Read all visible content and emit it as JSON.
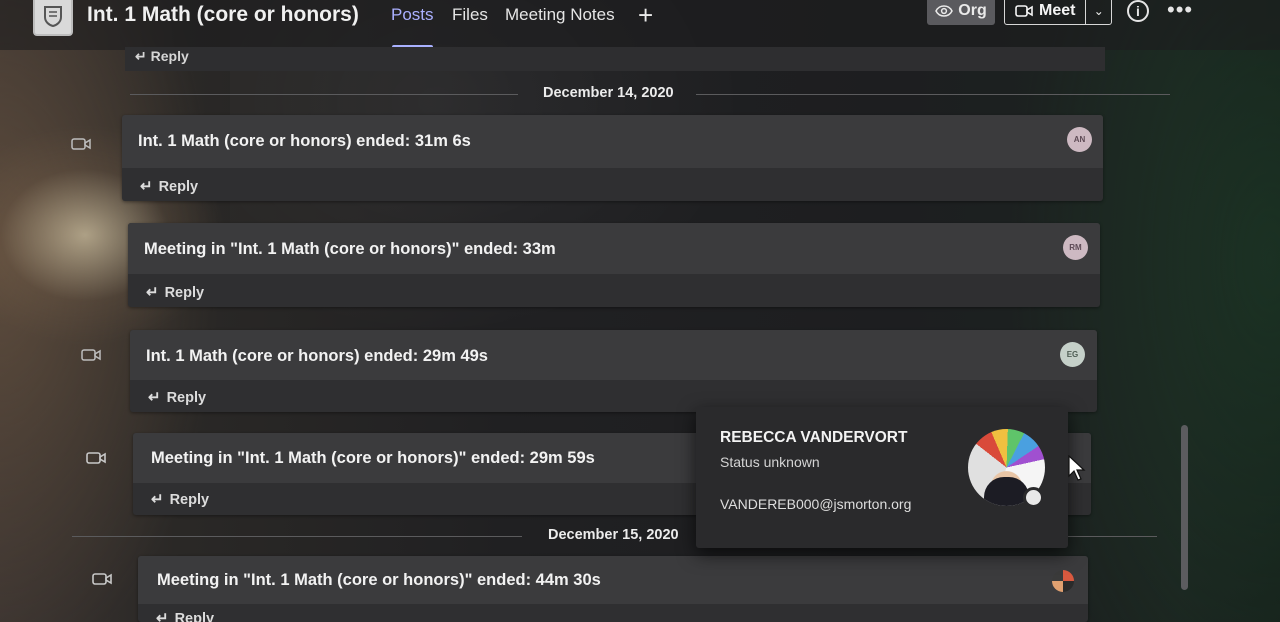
{
  "header": {
    "team_title": "Int. 1 Math (core or honors)",
    "tabs": [
      {
        "label": "Posts",
        "active": true
      },
      {
        "label": "Files",
        "active": false
      },
      {
        "label": "Meeting Notes",
        "active": false
      }
    ],
    "add_tab_icon": "plus-icon",
    "org_label": "Org",
    "meet_label": "Meet"
  },
  "feed": {
    "top_reply_label": "Reply",
    "groups": [
      {
        "date": "December 14, 2020",
        "posts": [
          {
            "message": "Int. 1 Math (core or honors) ended: 31m 6s",
            "avatar_initials": "AN",
            "reply_label": "Reply"
          },
          {
            "message": "Meeting in \"Int. 1 Math (core or honors)\" ended: 33m",
            "avatar_initials": "RM",
            "reply_label": "Reply"
          },
          {
            "message": "Int. 1 Math (core or honors) ended: 29m 49s",
            "avatar_initials": "EG",
            "reply_label": "Reply"
          },
          {
            "message": "Meeting in \"Int. 1 Math (core or honors)\" ended: 29m 59s",
            "avatar_initials": "",
            "reply_label": "Reply"
          }
        ]
      },
      {
        "date": "December 15, 2020",
        "posts": [
          {
            "message": "Meeting in \"Int. 1 Math (core or honors)\" ended: 44m 30s",
            "avatar_initials": "",
            "reply_label": "Reply"
          }
        ]
      }
    ]
  },
  "profile_card": {
    "name": "REBECCA VANDERVORT",
    "status": "Status unknown",
    "email": "VANDEREB000@jsmorton.org"
  },
  "colors": {
    "accent": "#a9b1ff",
    "card_top": "#3b3b3d",
    "card_bottom": "#2f2f31",
    "popup_bg": "#2a2a2c"
  }
}
